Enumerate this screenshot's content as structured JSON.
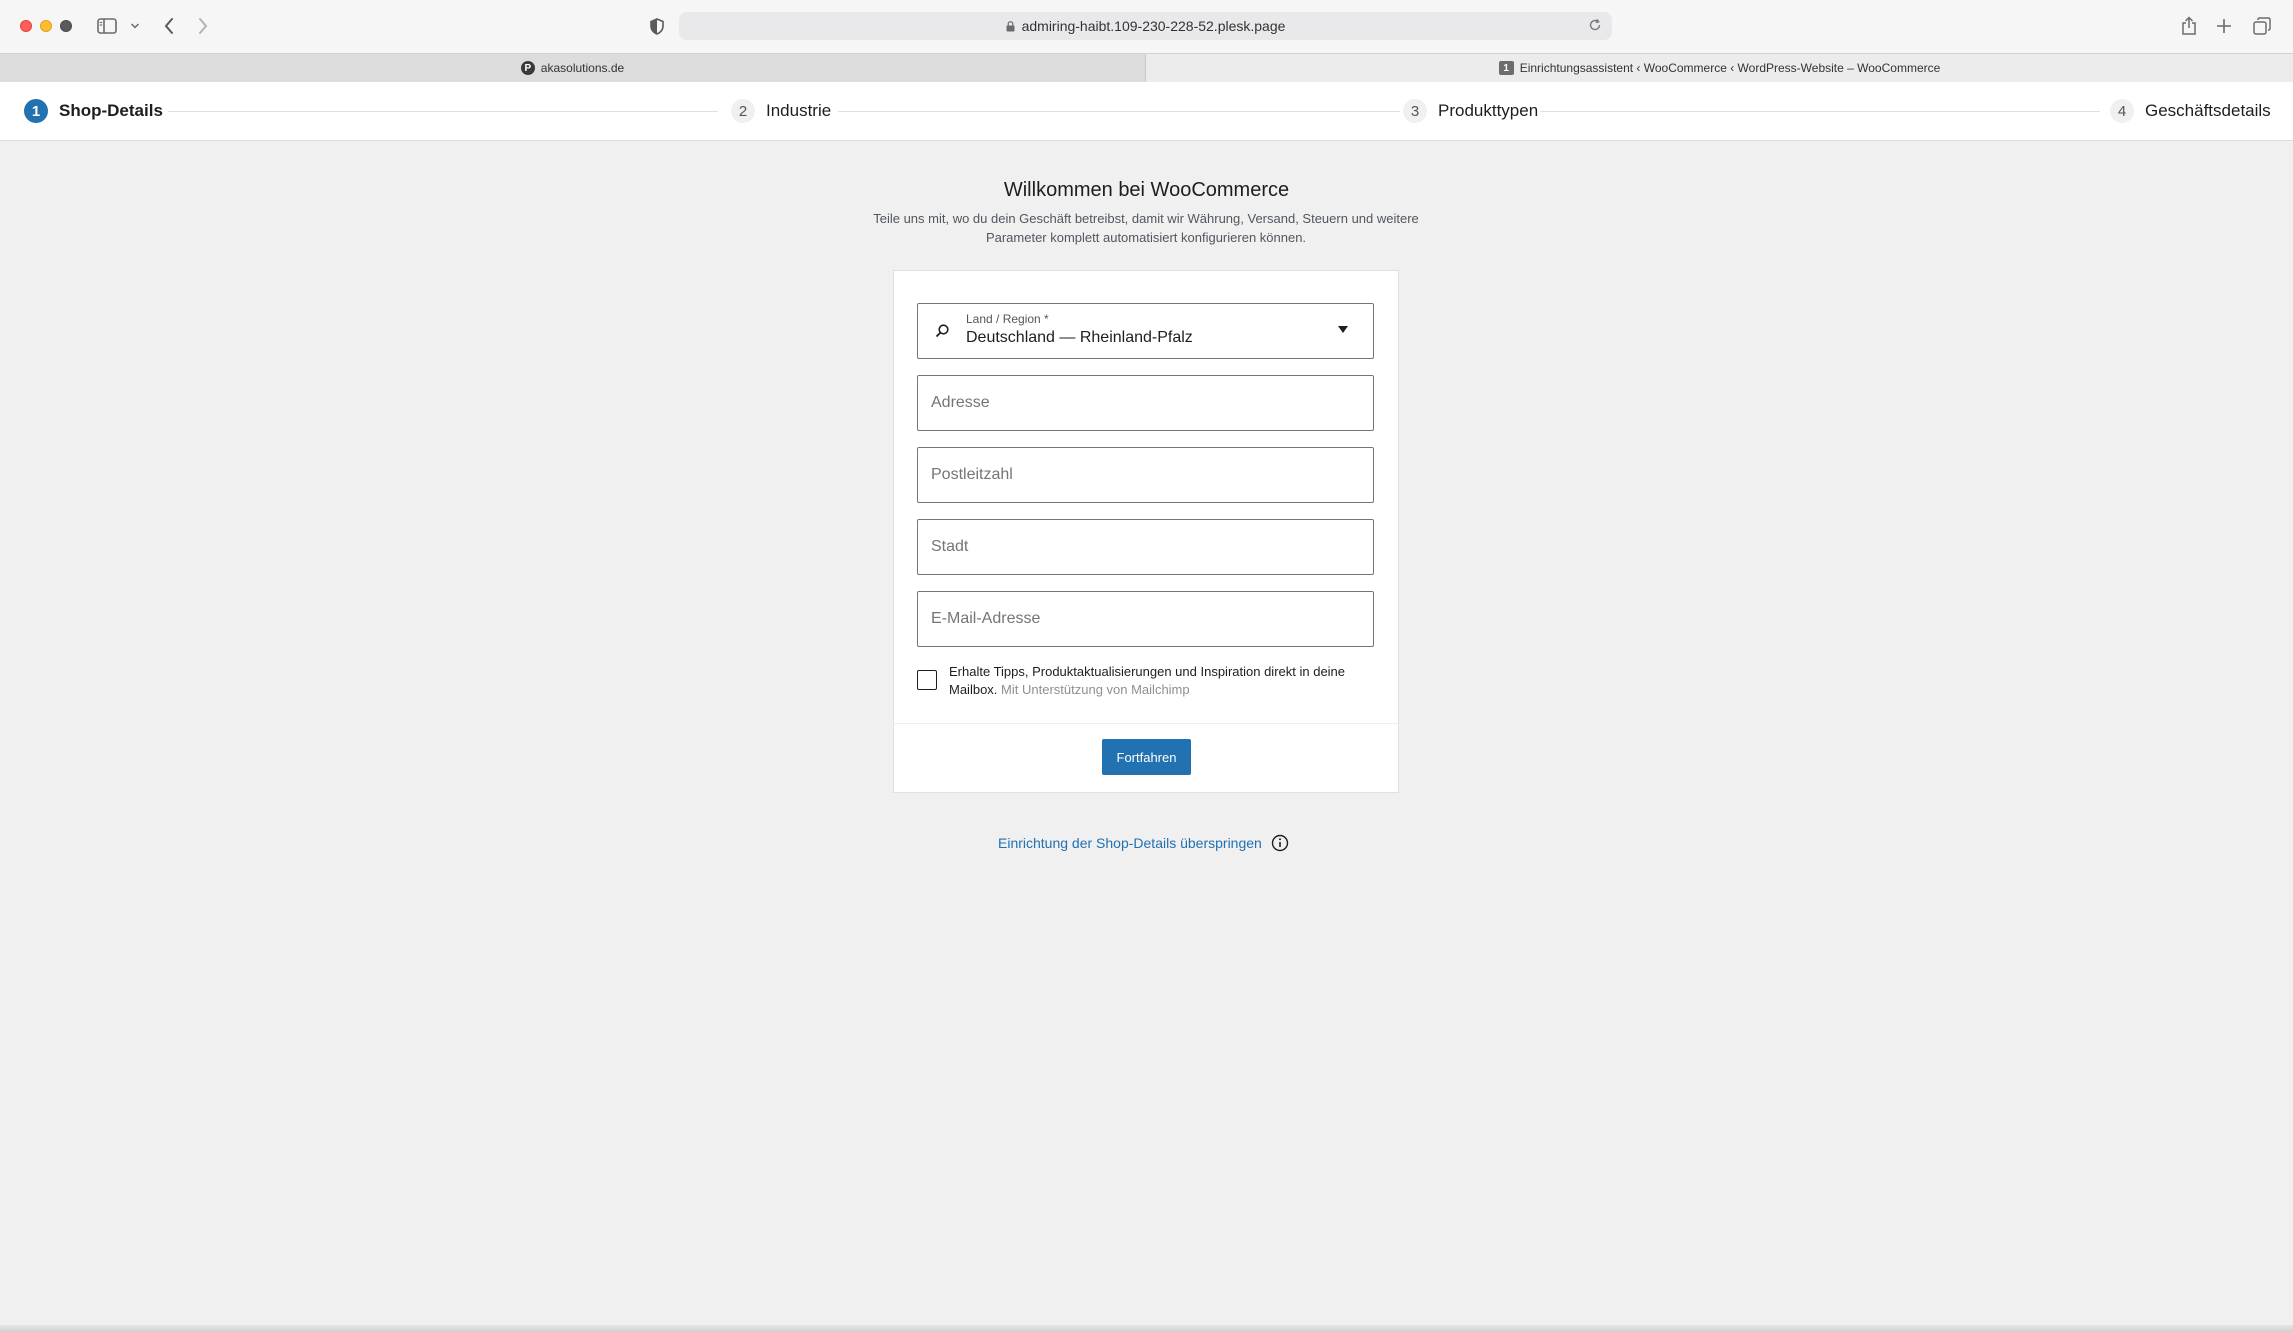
{
  "browser": {
    "url": "admiring-haibt.109-230-228-52.plesk.page",
    "tabs": [
      {
        "label": "akasolutions.de",
        "favicon": "P",
        "active": false
      },
      {
        "label": "Einrichtungsassistent ‹ WooCommerce ‹ WordPress-Website – WooCommerce",
        "favicon": "1",
        "active": true
      }
    ]
  },
  "stepper": {
    "steps": [
      {
        "number": "1",
        "label": "Shop-Details",
        "active": true
      },
      {
        "number": "2",
        "label": "Industrie",
        "active": false
      },
      {
        "number": "3",
        "label": "Produkttypen",
        "active": false
      },
      {
        "number": "4",
        "label": "Geschäftsdetails",
        "active": false
      }
    ]
  },
  "main": {
    "title": "Willkommen bei WooCommerce",
    "subtitle": "Teile uns mit, wo du dein Geschäft betreibst, damit wir Währung, Versand, Steuern und weitere Parameter komplett automatisiert konfigurieren können.",
    "form": {
      "country": {
        "label": "Land / Region *",
        "value": "Deutschland — Rheinland-Pfalz"
      },
      "address": {
        "placeholder": "Adresse"
      },
      "postcode": {
        "placeholder": "Postleitzahl"
      },
      "city": {
        "placeholder": "Stadt"
      },
      "email": {
        "placeholder": "E-Mail-Adresse"
      },
      "newsletter": {
        "checked": false,
        "text": "Erhalte Tipps, Produktaktualisierungen und Inspiration direkt in deine Mailbox.",
        "muted": "Mit Unterstützung von Mailchimp"
      },
      "submit_label": "Fortfahren"
    },
    "skip_link": "Einrichtung der Shop-Details überspringen"
  },
  "colors": {
    "accent": "#2271b1",
    "background": "#f0f0f1"
  }
}
